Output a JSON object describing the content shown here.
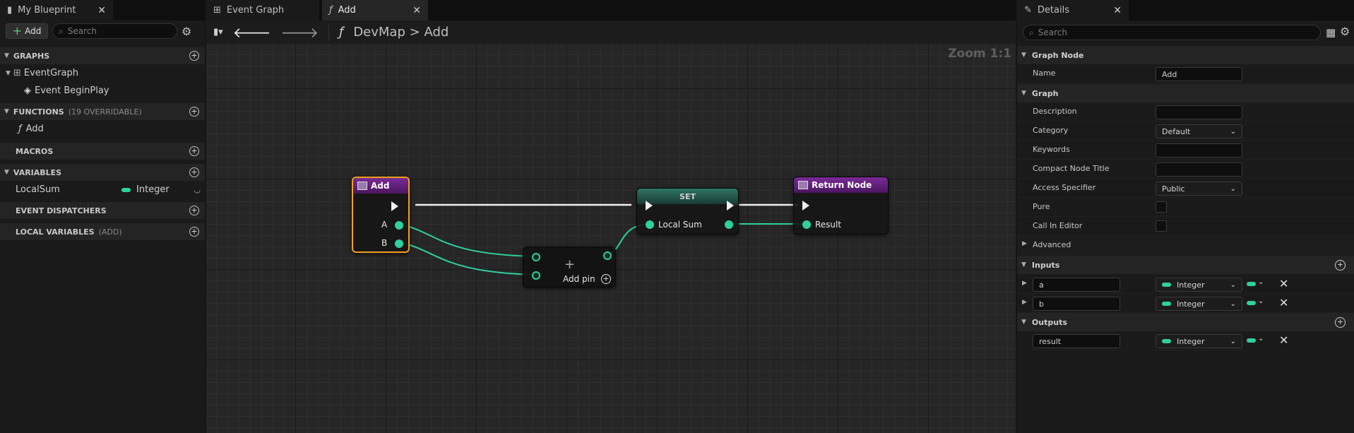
{
  "left_panel": {
    "tab_title": "My Blueprint",
    "add_label": "Add",
    "search_placeholder": "Search",
    "sections": {
      "graphs": "GRAPHS",
      "functions": "FUNCTIONS",
      "functions_note": "(19 OVERRIDABLE)",
      "macros": "MACROS",
      "variables": "VARIABLES",
      "event_dispatchers": "EVENT DISPATCHERS",
      "local_variables": "LOCAL VARIABLES",
      "local_variables_note": "(ADD)"
    },
    "graph_items": [
      "EventGraph",
      "Event BeginPlay"
    ],
    "function_items": [
      "Add"
    ],
    "variable_items": [
      {
        "name": "LocalSum",
        "type": "Integer"
      }
    ]
  },
  "graph": {
    "tabs": [
      "Event Graph",
      "Add"
    ],
    "breadcrumb": {
      "root": "DevMap",
      "sep": ">",
      "leaf": "Add"
    },
    "zoom": "Zoom 1:1",
    "nodes": {
      "entry": {
        "title": "Add",
        "pins": [
          "A",
          "B"
        ]
      },
      "set": {
        "title": "SET",
        "pin": "Local Sum"
      },
      "return": {
        "title": "Return Node",
        "pin": "Result"
      },
      "add_op": {
        "symbol": "+",
        "add_pin": "Add pin"
      }
    },
    "colors": {
      "integer_pin": "#2ed0a0",
      "function_header": "#6a1f8a",
      "selection": "#f0a020",
      "set_header": "#1f5a4a"
    }
  },
  "details": {
    "tab_title": "Details",
    "search_placeholder": "Search",
    "categories": {
      "graph_node": "Graph Node",
      "graph": "Graph",
      "advanced": "Advanced",
      "inputs": "Inputs",
      "outputs": "Outputs"
    },
    "rows": {
      "name_label": "Name",
      "name_value": "Add",
      "description_label": "Description",
      "category_label": "Category",
      "category_value": "Default",
      "keywords_label": "Keywords",
      "compact_label": "Compact Node Title",
      "access_label": "Access Specifier",
      "access_value": "Public",
      "pure_label": "Pure",
      "call_in_editor_label": "Call In Editor"
    },
    "inputs": [
      {
        "name": "a",
        "type": "Integer"
      },
      {
        "name": "b",
        "type": "Integer"
      }
    ],
    "outputs": [
      {
        "name": "result",
        "type": "Integer"
      }
    ]
  }
}
